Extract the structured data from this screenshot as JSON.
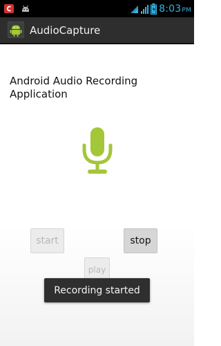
{
  "status_bar": {
    "time": "8:03",
    "ampm": "PM",
    "icons": [
      "notification-app-icon",
      "android-debug-icon",
      "wifi-icon",
      "signal-icon",
      "battery-icon"
    ]
  },
  "action_bar": {
    "title": "AudioCapture",
    "icon": "android-app-icon"
  },
  "main": {
    "heading": "Android Audio Recording Application",
    "mic_icon": "microphone-icon",
    "buttons": {
      "start": "start",
      "stop": "stop",
      "play": "play"
    },
    "toast": "Recording started"
  },
  "colors": {
    "status_time": "#33b5e5",
    "action_bar_bg": "#2e2e2e",
    "mic_green": "#a4c639"
  }
}
